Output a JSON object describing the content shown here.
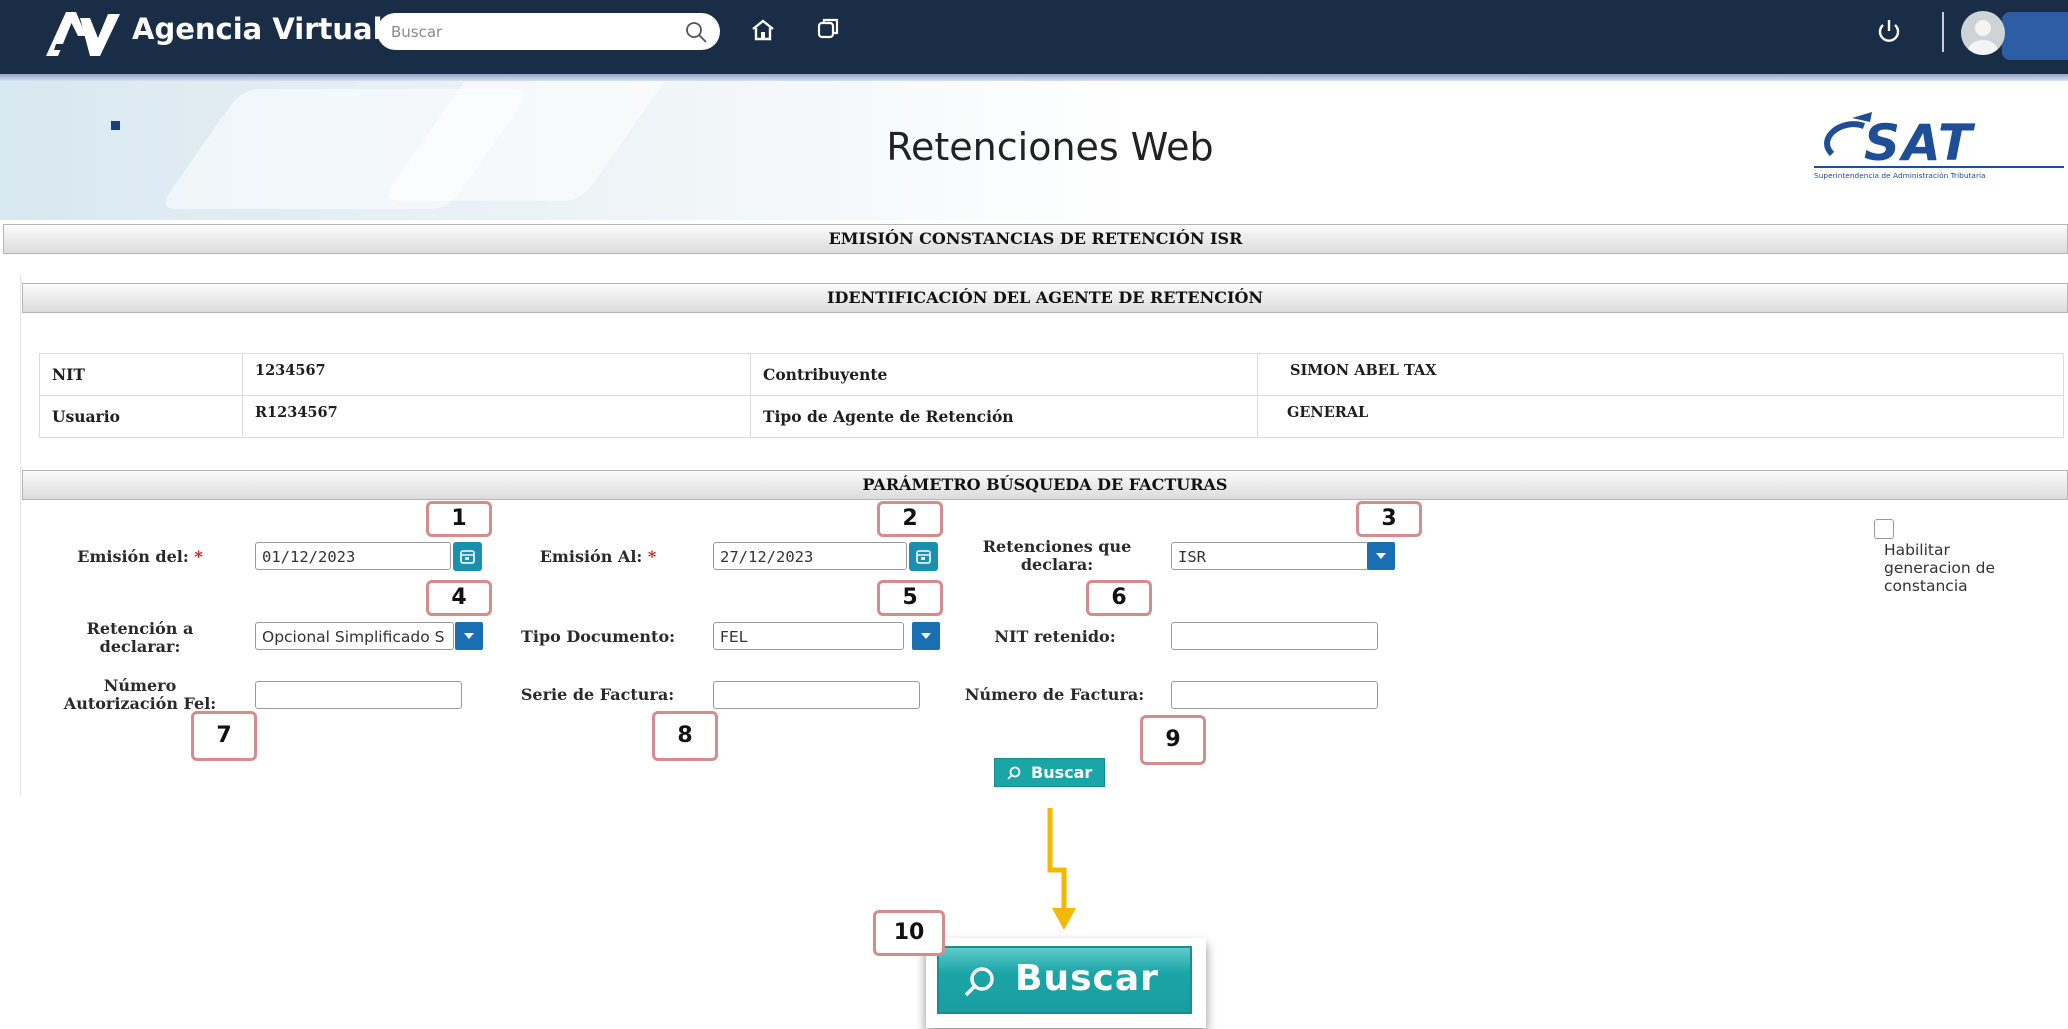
{
  "topbar": {
    "app_title": "Agencia Virtual",
    "search_placeholder": "Buscar"
  },
  "banner": {
    "title": "Retenciones Web",
    "logo_text": "SAT",
    "logo_subtitle": "Superintendencia de Administración Tributaria"
  },
  "sections": {
    "main": "EMISIÓN CONSTANCIAS DE RETENCIÓN ISR",
    "agent": "IDENTIFICACIÓN DEL AGENTE DE RETENCIÓN",
    "params": "PARÁMETRO BÚSQUEDA DE FACTURAS"
  },
  "agent": {
    "nit_label": "NIT",
    "nit_value": "1234567",
    "contribuyente_label": "Contribuyente",
    "contribuyente_value": "SIMON ABEL TAX",
    "usuario_label": "Usuario",
    "usuario_value": "R1234567",
    "tipo_label": "Tipo de Agente de Retención",
    "tipo_value": "GENERAL"
  },
  "form": {
    "emision_del_label": "Emisión del:",
    "emision_del_value": "01/12/2023",
    "emision_al_label": "Emisión Al:",
    "emision_al_value": "27/12/2023",
    "required_mark": "*",
    "retenciones_label_1": "Retenciones que",
    "retenciones_label_2": "declara:",
    "retenciones_value": "ISR",
    "retencion_label_1": "Retención a",
    "retencion_label_2": "declarar:",
    "retencion_value": "Opcional Simplificado S",
    "tipo_doc_label": "Tipo Documento:",
    "tipo_doc_value": "FEL",
    "nit_retenido_label": "NIT retenido:",
    "nit_retenido_value": "",
    "numero_aut_label_1": "Número",
    "numero_aut_label_2": "Autorización Fel:",
    "numero_aut_value": "",
    "serie_label": "Serie de Factura:",
    "serie_value": "",
    "numero_factura_label": "Número de Factura:",
    "numero_factura_value": "",
    "habilitar_line_1": "Habilitar",
    "habilitar_line_2": "generacion de",
    "habilitar_line_3": "constancia",
    "habilitar_checked": false,
    "buscar_label": "Buscar"
  },
  "annotations": [
    "1",
    "2",
    "3",
    "4",
    "5",
    "6",
    "7",
    "8",
    "9",
    "10"
  ],
  "zoom_button_label": "Buscar",
  "colors": {
    "topbar": "#1a2d47",
    "accent_teal": "#1aa5a7",
    "dropdown_blue": "#1a6fb3",
    "sat_blue": "#1d4e96",
    "arrow_yellow": "#f5b800",
    "annotation_border": "#d48c8c",
    "required": "#d21d1d"
  }
}
